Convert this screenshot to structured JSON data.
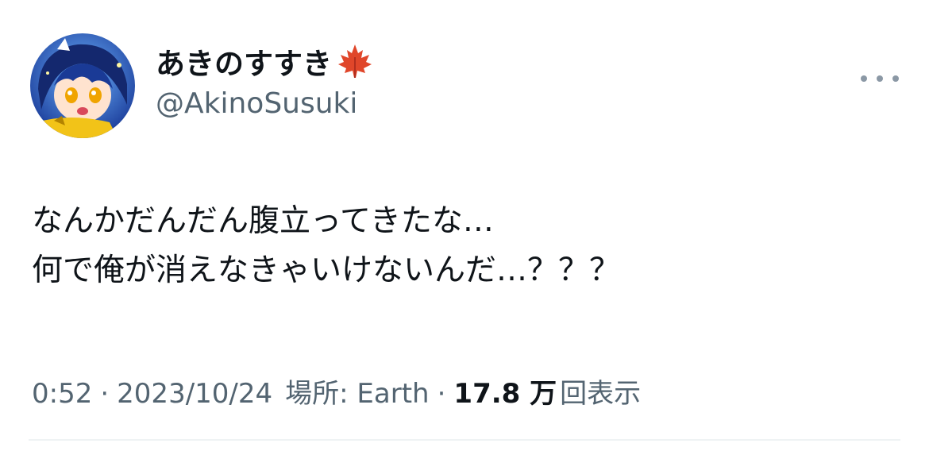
{
  "author": {
    "display_name": "あきのすすき",
    "handle": "@AkinoSusuki",
    "name_emoji_icon": "maple-leaf-icon",
    "avatar_icon": "anime-character-avatar"
  },
  "tweet": {
    "lines": [
      "なんかだんだん腹立ってきたな…",
      "何で俺が消えなきゃいけないんだ…？？？"
    ]
  },
  "meta": {
    "time": "0:52",
    "date": "2023/10/24",
    "location": "場所: Earth",
    "views_count": "17.8 万",
    "views_label": "回表示",
    "separator": "·"
  },
  "colors": {
    "text_primary": "#0f1419",
    "text_secondary": "#536471",
    "divider": "#eff3f4",
    "maple_leaf": "#e0462a"
  },
  "more_button_icon": "more-horizontal-icon"
}
